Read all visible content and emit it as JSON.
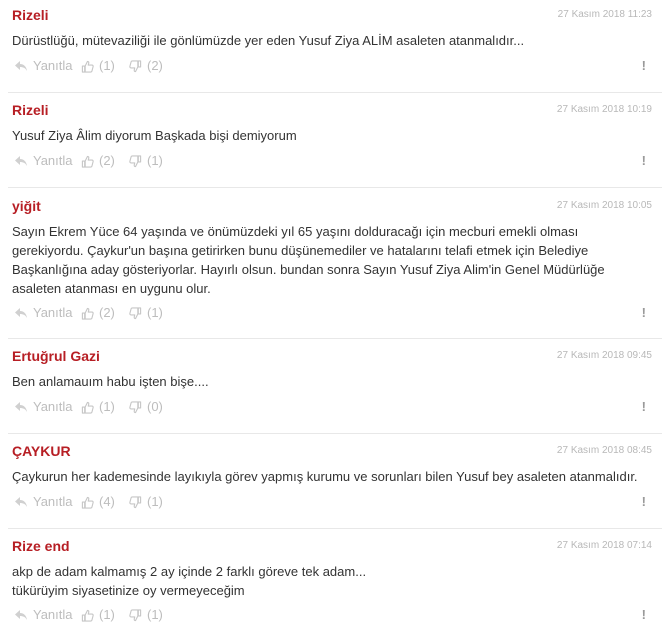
{
  "comments": [
    {
      "author": "Rizeli",
      "date": "27 Kasım 2018 11:23",
      "text": "Dürüstlüğü, mütevaziliği ile gönlümüzde yer eden Yusuf Ziya ALİM asaleten atanmalıdır...",
      "reply": "Yanıtla",
      "likes": "(1)",
      "dislikes": "(2)",
      "more": "!"
    },
    {
      "author": "Rizeli",
      "date": "27 Kasım 2018 10:19",
      "text": "Yusuf Ziya Âlim diyorum Başkada bişi demiyorum",
      "reply": "Yanıtla",
      "likes": "(2)",
      "dislikes": "(1)",
      "more": "!"
    },
    {
      "author": "yiğit",
      "date": "27 Kasım 2018 10:05",
      "text": "Sayın Ekrem Yüce 64 yaşında ve önümüzdeki yıl 65 yaşını dolduracağı için mecburi emekli olması gerekiyordu. Çaykur'un başına getirirken bunu düşünemediler ve hatalarını telafi etmek için Belediye Başkanlığına aday gösteriyorlar. Hayırlı olsun. bundan sonra Sayın Yusuf Ziya Alim'in Genel Müdürlüğe asaleten atanması en uygunu olur.",
      "reply": "Yanıtla",
      "likes": "(2)",
      "dislikes": "(1)",
      "more": "!"
    },
    {
      "author": "Ertuğrul Gazi",
      "date": "27 Kasım 2018 09:45",
      "text": "Ben anlamauım habu işten bişe....",
      "reply": "Yanıtla",
      "likes": "(1)",
      "dislikes": "(0)",
      "more": "!"
    },
    {
      "author": "ÇAYKUR",
      "date": "27 Kasım 2018 08:45",
      "text": "Çaykurun her kademesinde layıkıyla görev yapmış kurumu ve sorunları bilen Yusuf bey asaleten atanmalıdır.",
      "reply": "Yanıtla",
      "likes": "(4)",
      "dislikes": "(1)",
      "more": "!"
    },
    {
      "author": "Rize end",
      "date": "27 Kasım 2018 07:14",
      "text": "akp de adam kalmamış 2 ay içinde 2 farklı göreve tek adam... tükürüyim siyasetinize oy vermeyeceğim",
      "reply": "Yanıtla",
      "likes": "(1)",
      "dislikes": "(1)",
      "more": "!"
    }
  ]
}
